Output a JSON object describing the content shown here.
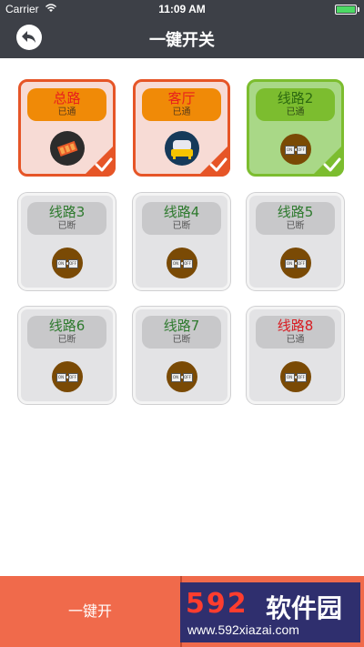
{
  "status_bar": {
    "carrier": "Carrier",
    "time": "11:09 AM"
  },
  "nav": {
    "title": "一键开关",
    "back_icon": "back-arrow-icon"
  },
  "cards": [
    {
      "name": "总路",
      "state": "已通",
      "style": "on-orange",
      "icon": "master-switch-icon",
      "checked": true
    },
    {
      "name": "客厅",
      "state": "已通",
      "style": "on-orange",
      "icon": "living-room-icon",
      "checked": true
    },
    {
      "name": "线路2",
      "state": "已通",
      "style": "on-green",
      "icon": "switch-icon",
      "checked": true
    },
    {
      "name": "线路3",
      "state": "已断",
      "style": "off",
      "icon": "switch-icon",
      "checked": false
    },
    {
      "name": "线路4",
      "state": "已断",
      "style": "off",
      "icon": "switch-icon",
      "checked": false
    },
    {
      "name": "线路5",
      "state": "已断",
      "style": "off",
      "icon": "switch-icon",
      "checked": false
    },
    {
      "name": "线路6",
      "state": "已断",
      "style": "off",
      "icon": "switch-icon",
      "checked": false
    },
    {
      "name": "线路7",
      "state": "已断",
      "style": "off",
      "icon": "switch-icon",
      "checked": false
    },
    {
      "name": "线路8",
      "state": "已通",
      "style": "off",
      "name_color": "red",
      "icon": "switch-icon",
      "checked": false
    }
  ],
  "switch_labels": {
    "on": "ON",
    "off": "OFF"
  },
  "bottom": {
    "one_key_label": "一键开"
  },
  "watermark": {
    "logo": "592",
    "text": "软件园",
    "url": "www.592xiazai.com"
  },
  "colors": {
    "nav_bg": "#3d4047",
    "accent_orange": "#e65527",
    "accent_green": "#7cbd2f",
    "bottom_btn": "#f06a4b"
  }
}
